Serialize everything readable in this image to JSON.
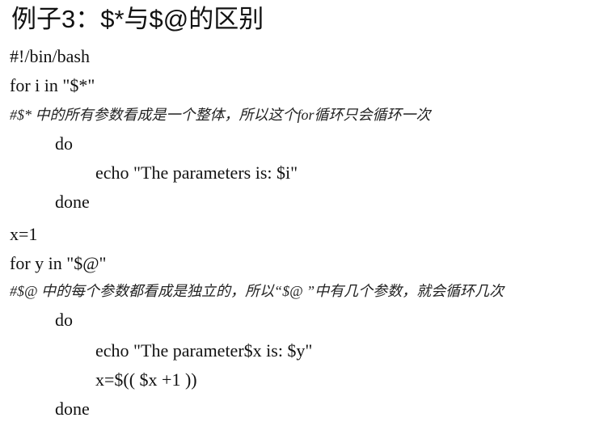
{
  "title": "例子3：$*与$@的区别",
  "code": {
    "shebang": "#!/bin/bash",
    "for_star": "for i in \"$*\"",
    "comment_star": "#$* 中的所有参数看成是一个整体，所以这个for循环只会循环一次",
    "do1": "do",
    "echo1": "echo \"The  parameters  is:  $i\"",
    "done1": "done",
    "x_init": "x=1",
    "for_at": "for y in \"$@\"",
    "comment_at": "#$@ 中的每个参数都看成是独立的，所以“$@ ”中有几个参数，就会循环几次",
    "do2": "do",
    "echo2": "echo \"The  parameter$x  is:  $y\"",
    "x_incr": "x=$(( $x +1 ))",
    "done2": "done"
  }
}
